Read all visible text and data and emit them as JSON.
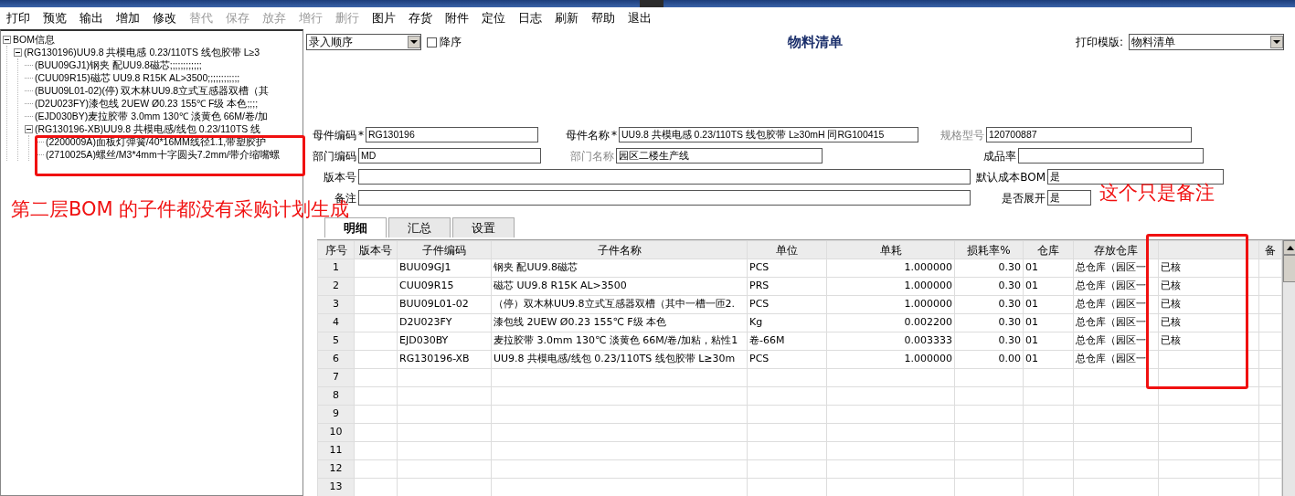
{
  "toolbar": [
    {
      "label": "打印",
      "disabled": false
    },
    {
      "label": "预览",
      "disabled": false
    },
    {
      "label": "输出",
      "disabled": false
    },
    {
      "label": "增加",
      "disabled": false
    },
    {
      "label": "修改",
      "disabled": false
    },
    {
      "label": "替代",
      "disabled": true
    },
    {
      "label": "保存",
      "disabled": true
    },
    {
      "label": "放弃",
      "disabled": true
    },
    {
      "label": "增行",
      "disabled": true
    },
    {
      "label": "删行",
      "disabled": true
    },
    {
      "label": "图片",
      "disabled": false
    },
    {
      "label": "存货",
      "disabled": false
    },
    {
      "label": "附件",
      "disabled": false
    },
    {
      "label": "定位",
      "disabled": false
    },
    {
      "label": "日志",
      "disabled": false
    },
    {
      "label": "刷新",
      "disabled": false
    },
    {
      "label": "帮助",
      "disabled": false
    },
    {
      "label": "退出",
      "disabled": false
    }
  ],
  "tree": [
    {
      "label": "BOM信息",
      "expanded": true,
      "children": [
        {
          "label": "(RG130196)UU9.8 共模电感 0.23/110TS 线包胶带 L≥3",
          "expanded": true,
          "children": [
            {
              "label": "(BUU09GJ1)钢夹 配UU9.8磁芯;;;;;;;;;;;;"
            },
            {
              "label": "(CUU09R15)磁芯 UU9.8 R15K AL>3500;;;;;;;;;;;;"
            },
            {
              "label": "(BUU09L01-02)(停) 双木林UU9.8立式互感器双槽（其"
            },
            {
              "label": "(D2U023FY)漆包线 2UEW Ø0.23 155℃ F级 本色;;;;"
            },
            {
              "label": "(EJD030BY)麦拉胶带 3.0mm 130℃ 淡黄色 66M/卷/加"
            },
            {
              "label": "(RG130196-XB)UU9.8 共模电感/线包 0.23/110TS 线",
              "expanded": true,
              "children": [
                {
                  "label": "(2200009A)面板灯弹簧/40*16MM线径1.1,带塑胶护"
                },
                {
                  "label": "(2710025A)螺丝/M3*4mm十字圆头7.2mm/带介缩嘴螺"
                }
              ]
            }
          ]
        }
      ]
    }
  ],
  "sort_select": {
    "value": "录入顺序"
  },
  "descending": {
    "label": "降序",
    "checked": false
  },
  "title": "物料清单",
  "print_template": {
    "label": "打印模版:",
    "value": "物料清单"
  },
  "form": [
    [
      {
        "label": "母件编码",
        "required_mark": "*",
        "disabled": false,
        "value": "RG130196"
      },
      {
        "label": "母件名称",
        "required_mark": "*",
        "disabled": false,
        "value": "UU9.8 共模电感 0.23/110TS 线包胶带 L≥30mH  同RG100415"
      },
      {
        "label": "规格型号",
        "disabled": true,
        "value": "120700887"
      }
    ],
    [
      {
        "label": "部门编码",
        "disabled": false,
        "value": "MD"
      },
      {
        "label": "部门名称",
        "disabled": true,
        "value": "园区二楼生产线"
      },
      {
        "label": "成品率",
        "disabled": false
      }
    ],
    [
      {
        "label": "版本号",
        "disabled": false
      },
      {
        "label": "默认成本BOM",
        "disabled": false,
        "value": "是"
      }
    ],
    [
      {
        "label": "备注",
        "disabled": false
      },
      {
        "label": "是否展开",
        "disabled": false,
        "value": "是"
      }
    ]
  ],
  "tabs": [
    {
      "label": "明细",
      "selected": true
    },
    {
      "label": "汇总",
      "selected": false
    },
    {
      "label": "设置",
      "selected": false
    }
  ],
  "table": {
    "columns": [
      "序号",
      "版本号",
      "子件编码",
      "子件名称",
      "单位",
      "单耗",
      "损耗率%",
      "仓库",
      "存放仓库",
      "",
      "备"
    ],
    "rows": [
      [
        "1",
        "",
        "BUU09GJ1",
        "钢夹 配UU9.8磁芯",
        "PCS",
        "1.000000",
        "0.30",
        "01",
        "总仓库（园区一",
        "已核"
      ],
      [
        "2",
        "",
        "CUU09R15",
        "磁芯 UU9.8 R15K AL>3500",
        "PRS",
        "1.000000",
        "0.30",
        "01",
        "总仓库（园区一",
        "已核"
      ],
      [
        "3",
        "",
        "BUU09L01-02",
        "（停）双木林UU9.8立式互感器双槽（其中一槽一匝2.",
        "PCS",
        "1.000000",
        "0.30",
        "01",
        "总仓库（园区一",
        "已核"
      ],
      [
        "4",
        "",
        "D2U023FY",
        "漆包线 2UEW Ø0.23 155℃ F级 本色",
        "Kg",
        "0.002200",
        "0.30",
        "01",
        "总仓库（园区一",
        "已核"
      ],
      [
        "5",
        "",
        "EJD030BY",
        "麦拉胶带 3.0mm 130℃ 淡黄色 66M/卷/加粘，粘性1",
        "卷-66M",
        "0.003333",
        "0.30",
        "01",
        "总仓库（园区一",
        "已核"
      ],
      [
        "6",
        "",
        "RG130196-XB",
        "UU9.8 共模电感/线包 0.23/110TS 线包胶带 L≥30m",
        "PCS",
        "1.000000",
        "0.00",
        "01",
        "总仓库（园区一",
        ""
      ],
      [
        "7"
      ],
      [
        "8"
      ],
      [
        "9"
      ],
      [
        "10"
      ],
      [
        "11"
      ],
      [
        "12"
      ],
      [
        "13"
      ]
    ]
  },
  "annotations": [
    {
      "text": "第二层BOM 的子件都没有采购计划生成"
    },
    {
      "text": "这个只是备注"
    }
  ]
}
